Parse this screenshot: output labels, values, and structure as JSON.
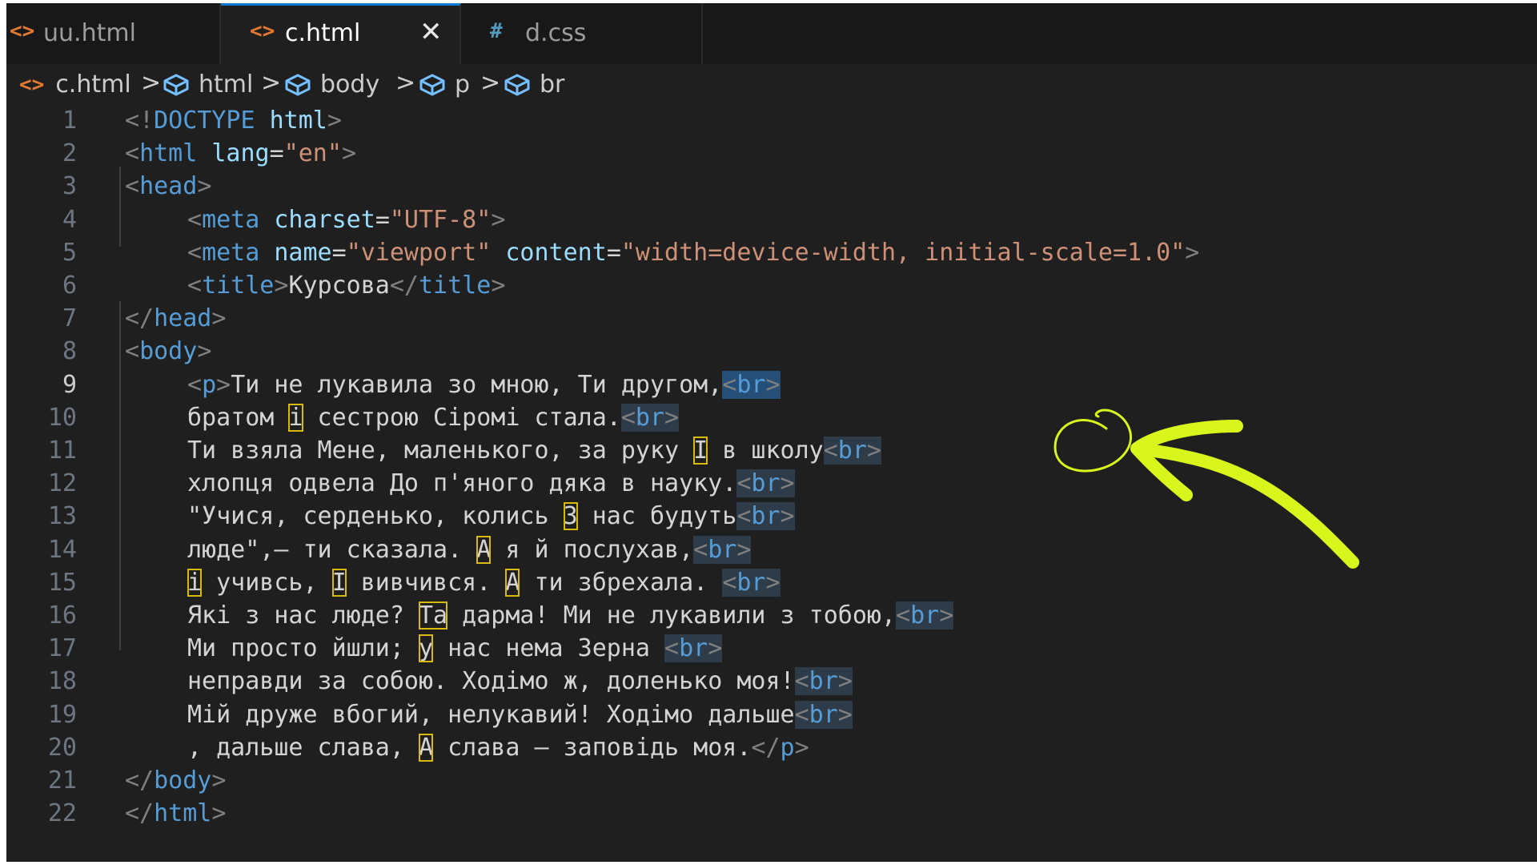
{
  "tabs": [
    {
      "icon": "<>",
      "label": "uu.html"
    },
    {
      "icon": "<>",
      "label": "c.html",
      "close": "✕"
    },
    {
      "icon": "#",
      "label": "d.css"
    }
  ],
  "breadcrumb": {
    "sep": ">",
    "items": [
      {
        "icon": "html-file-icon",
        "label": "c.html"
      },
      {
        "icon": "element-cube-icon",
        "label": "html"
      },
      {
        "icon": "element-cube-icon",
        "label": "body"
      },
      {
        "icon": "element-cube-icon",
        "label": "p"
      },
      {
        "icon": "element-cube-icon",
        "label": "br"
      }
    ]
  },
  "editor": {
    "current_line": 9,
    "lines": [
      {
        "num": "1",
        "indent": 0,
        "seg": [
          {
            "c": "tg",
            "t": "<!"
          },
          {
            "c": "tn",
            "t": "DOCTYPE"
          },
          {
            "c": "tx",
            "t": " "
          },
          {
            "c": "an",
            "t": "html"
          },
          {
            "c": "tg",
            "t": ">"
          }
        ]
      },
      {
        "num": "2",
        "indent": 0,
        "seg": [
          {
            "c": "tg",
            "t": "<"
          },
          {
            "c": "tn",
            "t": "html"
          },
          {
            "c": "tx",
            "t": " "
          },
          {
            "c": "an",
            "t": "lang"
          },
          {
            "c": "tx",
            "t": "="
          },
          {
            "c": "av",
            "t": "\"en\""
          },
          {
            "c": "tg",
            "t": ">"
          }
        ]
      },
      {
        "num": "3",
        "indent": 0,
        "seg": [
          {
            "c": "tg",
            "t": "<"
          },
          {
            "c": "tn",
            "t": "head"
          },
          {
            "c": "tg",
            "t": ">"
          }
        ]
      },
      {
        "num": "4",
        "indent": 1,
        "seg": [
          {
            "c": "tg",
            "t": "<"
          },
          {
            "c": "tn",
            "t": "meta"
          },
          {
            "c": "tx",
            "t": " "
          },
          {
            "c": "an",
            "t": "charset"
          },
          {
            "c": "tx",
            "t": "="
          },
          {
            "c": "av",
            "t": "\"UTF-8\""
          },
          {
            "c": "tg",
            "t": ">"
          }
        ]
      },
      {
        "num": "5",
        "indent": 1,
        "seg": [
          {
            "c": "tg",
            "t": "<"
          },
          {
            "c": "tn",
            "t": "meta"
          },
          {
            "c": "tx",
            "t": " "
          },
          {
            "c": "an",
            "t": "name"
          },
          {
            "c": "tx",
            "t": "="
          },
          {
            "c": "av",
            "t": "\"viewport\""
          },
          {
            "c": "tx",
            "t": " "
          },
          {
            "c": "an",
            "t": "content"
          },
          {
            "c": "tx",
            "t": "="
          },
          {
            "c": "av",
            "t": "\"width=device-width, initial-scale=1.0\""
          },
          {
            "c": "tg",
            "t": ">"
          }
        ]
      },
      {
        "num": "6",
        "indent": 1,
        "seg": [
          {
            "c": "tg",
            "t": "<"
          },
          {
            "c": "tn",
            "t": "title"
          },
          {
            "c": "tg",
            "t": ">"
          },
          {
            "c": "tx",
            "t": "Курсова"
          },
          {
            "c": "tg",
            "t": "</"
          },
          {
            "c": "tn",
            "t": "title"
          },
          {
            "c": "tg",
            "t": ">"
          }
        ]
      },
      {
        "num": "7",
        "indent": 0,
        "seg": [
          {
            "c": "tg",
            "t": "</"
          },
          {
            "c": "tn",
            "t": "head"
          },
          {
            "c": "tg",
            "t": ">"
          }
        ]
      },
      {
        "num": "8",
        "indent": 0,
        "seg": [
          {
            "c": "tg",
            "t": "<"
          },
          {
            "c": "tn",
            "t": "body"
          },
          {
            "c": "tg",
            "t": ">"
          }
        ]
      },
      {
        "num": "9",
        "indent": 1,
        "seg": [
          {
            "c": "tg",
            "t": "<"
          },
          {
            "c": "tn",
            "t": "p"
          },
          {
            "c": "tg",
            "t": ">"
          },
          {
            "c": "tx",
            "t": "Ти не лукавила зо мною, Ти другом,"
          },
          {
            "c": "brs",
            "t": "<br>"
          }
        ]
      },
      {
        "num": "10",
        "indent": 1,
        "seg": [
          {
            "c": "tx",
            "t": "братом "
          },
          {
            "c": "uni",
            "t": "і"
          },
          {
            "c": "tx",
            "t": " сестрою Сіромі стала."
          },
          {
            "c": "br",
            "t": "<br>"
          }
        ]
      },
      {
        "num": "11",
        "indent": 1,
        "seg": [
          {
            "c": "tx",
            "t": "Ти взяла Мене, маленького, за руку "
          },
          {
            "c": "uni",
            "t": "І"
          },
          {
            "c": "tx",
            "t": " в школу"
          },
          {
            "c": "br",
            "t": "<br>"
          }
        ]
      },
      {
        "num": "12",
        "indent": 1,
        "seg": [
          {
            "c": "tx",
            "t": "хлопця одвела До п'яного дяка в науку."
          },
          {
            "c": "br",
            "t": "<br>"
          }
        ]
      },
      {
        "num": "13",
        "indent": 1,
        "seg": [
          {
            "c": "tx",
            "t": "\"Учися, серденько, колись "
          },
          {
            "c": "uni",
            "t": "З"
          },
          {
            "c": "tx",
            "t": " нас будуть"
          },
          {
            "c": "br",
            "t": "<br>"
          }
        ]
      },
      {
        "num": "14",
        "indent": 1,
        "seg": [
          {
            "c": "tx",
            "t": "люде\",— ти сказала. "
          },
          {
            "c": "uni",
            "t": "А"
          },
          {
            "c": "tx",
            "t": " я й послухав,"
          },
          {
            "c": "br",
            "t": "<br>"
          }
        ]
      },
      {
        "num": "15",
        "indent": 1,
        "seg": [
          {
            "c": "uni",
            "t": "і"
          },
          {
            "c": "tx",
            "t": " учивсь, "
          },
          {
            "c": "uni",
            "t": "І"
          },
          {
            "c": "tx",
            "t": " вивчився. "
          },
          {
            "c": "uni",
            "t": "А"
          },
          {
            "c": "tx",
            "t": " ти збрехала. "
          },
          {
            "c": "br",
            "t": "<br>"
          }
        ]
      },
      {
        "num": "16",
        "indent": 1,
        "seg": [
          {
            "c": "tx",
            "t": "Які з нас люде? "
          },
          {
            "c": "uni",
            "t": "Та"
          },
          {
            "c": "tx",
            "t": " дарма! Ми не лукавили з тобою,"
          },
          {
            "c": "br",
            "t": "<br>"
          }
        ]
      },
      {
        "num": "17",
        "indent": 1,
        "seg": [
          {
            "c": "tx",
            "t": "Ми просто йшли; "
          },
          {
            "c": "uni",
            "t": "у"
          },
          {
            "c": "tx",
            "t": " нас нема Зерна "
          },
          {
            "c": "br",
            "t": "<br>"
          }
        ]
      },
      {
        "num": "18",
        "indent": 1,
        "seg": [
          {
            "c": "tx",
            "t": "неправди за собою. Ходімо ж, доленько моя!"
          },
          {
            "c": "br",
            "t": "<br>"
          }
        ]
      },
      {
        "num": "19",
        "indent": 1,
        "seg": [
          {
            "c": "tx",
            "t": "Мій друже вбогий, нелукавий! Ходімо дальше"
          },
          {
            "c": "br",
            "t": "<br>"
          }
        ]
      },
      {
        "num": "20",
        "indent": 1,
        "seg": [
          {
            "c": "tx",
            "t": ", дальше слава, "
          },
          {
            "c": "uni",
            "t": "А"
          },
          {
            "c": "tx",
            "t": " слава — заповідь моя."
          },
          {
            "c": "tg",
            "t": "</"
          },
          {
            "c": "tn",
            "t": "p"
          },
          {
            "c": "tg",
            "t": ">"
          }
        ]
      },
      {
        "num": "21",
        "indent": 0,
        "seg": [
          {
            "c": "tg",
            "t": "</"
          },
          {
            "c": "tn",
            "t": "body"
          },
          {
            "c": "tg",
            "t": ">"
          }
        ]
      },
      {
        "num": "22",
        "indent": 0,
        "seg": [
          {
            "c": "tg",
            "t": "</"
          },
          {
            "c": "tn",
            "t": "html"
          },
          {
            "c": "tg",
            "t": ">"
          }
        ]
      }
    ]
  },
  "annotation": {
    "color": "#d8f51c",
    "shapes": [
      "circle-mark",
      "arrow-mark"
    ]
  },
  "colors": {
    "background": "#1f1f1f",
    "tab_bar": "#181818",
    "tag_bracket": "#808080",
    "tag_name": "#569cd6",
    "attr_name": "#9cdcfe",
    "attr_value": "#ce9178",
    "text": "#d4d4d4",
    "line_number": "#6e7681",
    "unicode_highlight": "#d7ba0b",
    "html_icon": "#e37933",
    "css_icon": "#519aba"
  }
}
